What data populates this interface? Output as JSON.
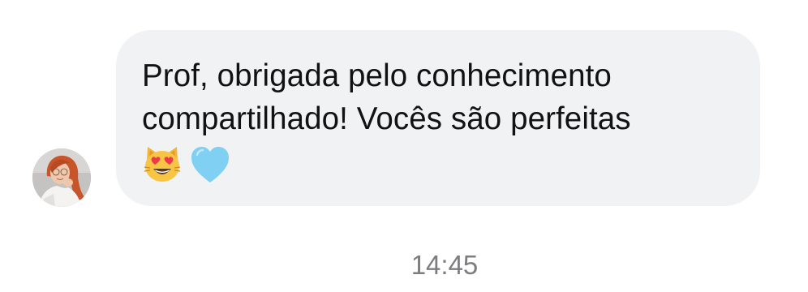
{
  "message": {
    "line1": "Prof, obrigada pelo conhecimento",
    "line2": "compartilhado! Vocês são perfeitas",
    "emojis": [
      "heart-eyes-cat-icon",
      "light-blue-heart-icon"
    ]
  },
  "timestamp": "14:45",
  "colors": {
    "bubble": "#f1f2f4",
    "text": "#121212",
    "timestamp": "#7d7d80",
    "heart": "#7fd0f2"
  }
}
